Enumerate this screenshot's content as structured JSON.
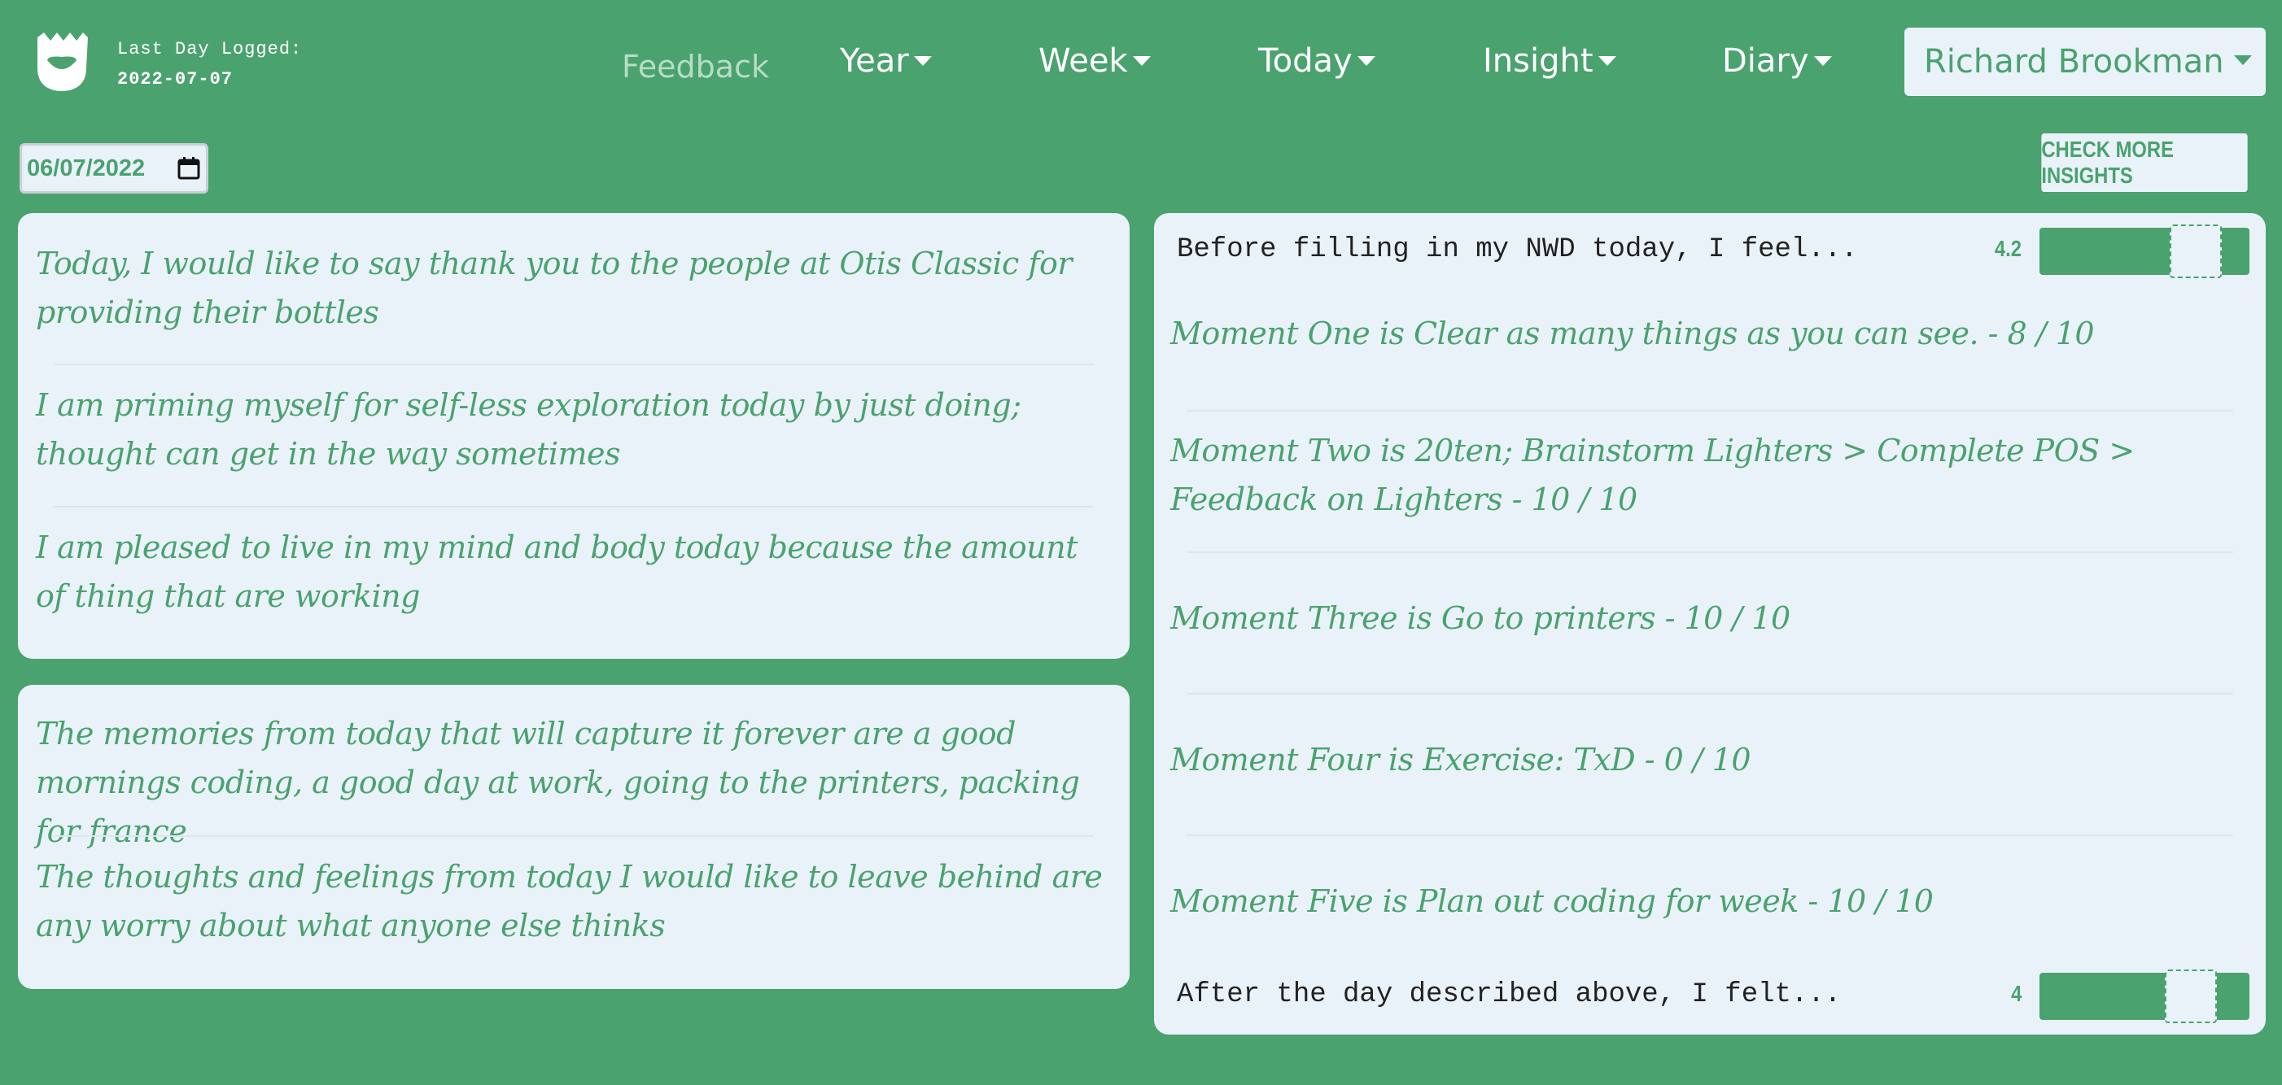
{
  "header": {
    "last_logged_label": "Last Day Logged:",
    "last_logged_value": "2022-07-07",
    "nav": {
      "feedback": "Feedback",
      "year": "Year",
      "week": "Week",
      "today": "Today",
      "insight": "Insight",
      "diary": "Diary"
    },
    "user": "Richard Brookman"
  },
  "date_input": {
    "value": "06/07/2022"
  },
  "insights_button": "CHECK MORE INSIGHTS",
  "gratitude": [
    "Today, I would like to say thank you to the people at Otis Classic for providing their bottles",
    "I am priming myself for self-less exploration today by just doing; thought can get in the way sometimes",
    "I am pleased to live in my mind and body today because the amount of thing that are working"
  ],
  "reflections": [
    "The memories from today that will capture it forever are a good mornings coding, a good day at work, going to the printers, packing for france",
    "The thoughts and feelings from today I would like to leave behind are any worry about what anyone else thinks"
  ],
  "before": {
    "label": "Before filling in my NWD today, I feel...",
    "value": "4.2"
  },
  "moments": [
    "Moment One is Clear as many things as you can see. - 8 / 10",
    "Moment Two is 20ten; Brainstorm Lighters > Complete POS > Feedback on Lighters - 10 / 10",
    "Moment Three is Go to printers - 10 / 10",
    "Moment Four is Exercise: TxD - 0 / 10",
    "Moment Five is Plan out coding for week - 10 / 10"
  ],
  "after": {
    "label": "After the day described above, I felt...",
    "value": "4"
  }
}
